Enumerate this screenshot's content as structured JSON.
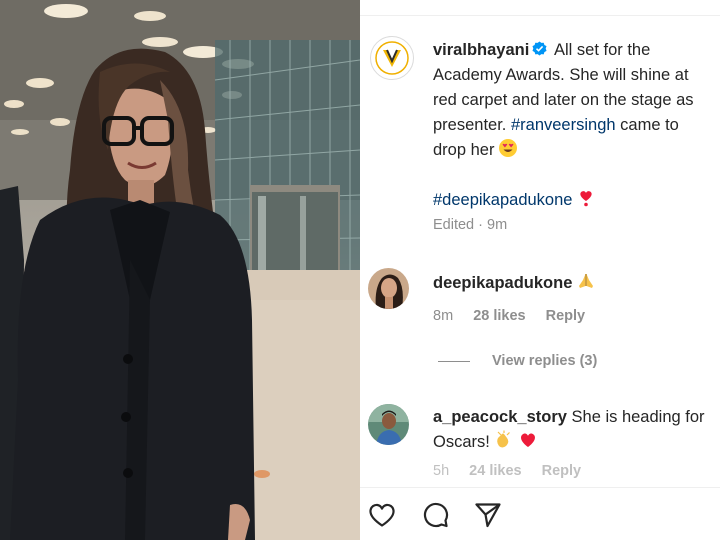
{
  "post": {
    "author": "viralbhayani",
    "caption_line1": "All set for the",
    "caption_line2": "Academy Awards. She will shine at",
    "caption_line3": "red carpet and later on the stage as",
    "caption_line4_pre": "presenter.",
    "caption_line4_tag": "#ranveersingh",
    "caption_line4_post": "came to",
    "caption_line5": "drop her",
    "hashtag": "#deepikapadukone",
    "edited": "Edited · 9m"
  },
  "comments": [
    {
      "username": "deepikapadukone",
      "text": "",
      "time": "8m",
      "likes": "28 likes",
      "reply": "Reply",
      "view_replies": "View replies (3)"
    },
    {
      "username": "a_peacock_story",
      "text_line1": "She is heading for",
      "text_line2": "Oscars!",
      "time": "5h",
      "likes": "24 likes",
      "reply": "Reply"
    }
  ],
  "icons": {
    "like": "heart-icon",
    "comment": "comment-icon",
    "share": "send-icon",
    "verified": "verified-badge-icon"
  },
  "colors": {
    "hashtag": "#00376b",
    "verified": "#0095f6",
    "meta": "#8e8e8e",
    "heart_red": "#ed1b3a"
  }
}
